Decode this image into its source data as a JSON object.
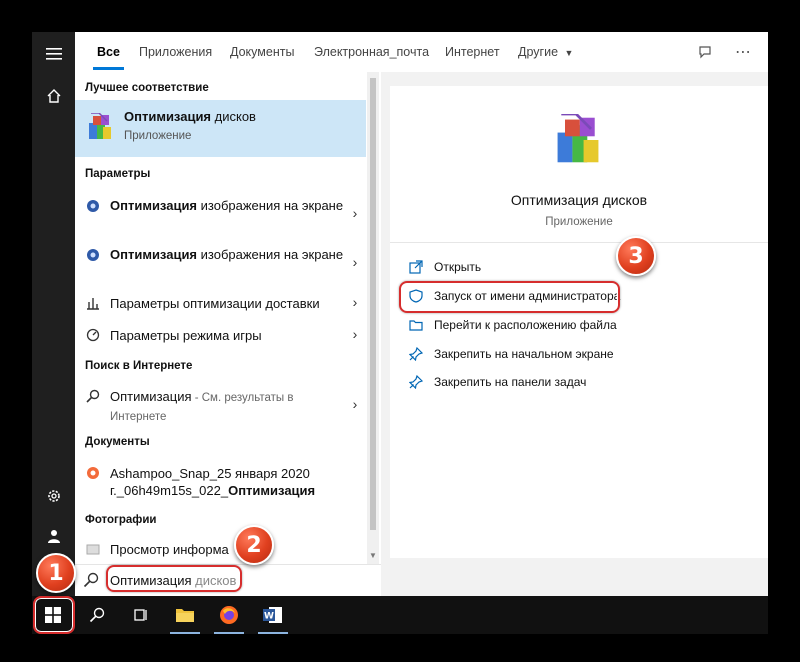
{
  "tabs": {
    "all": "Все",
    "apps": "Приложения",
    "docs": "Документы",
    "email": "Электронная_почта",
    "web": "Интернет",
    "more": "Другие"
  },
  "left": {
    "best_match_heading": "Лучшее соответствие",
    "best": {
      "title_bold": "Оптимизация",
      "title_rest": " дисков",
      "subtitle": "Приложение"
    },
    "settings_heading": "Параметры",
    "settings": [
      {
        "bold": "Оптимизация",
        "rest": " изображения на экране"
      },
      {
        "bold": "Оптимизация",
        "rest": " изображения на экране"
      },
      {
        "bold": "",
        "rest": "Параметры оптимизации доставки"
      },
      {
        "bold": "",
        "rest": "Параметры режима игры"
      }
    ],
    "web_heading": "Поиск в Интернете",
    "web_item": {
      "bold": "Оптимизация",
      "rest": " - См. результаты в Интернете"
    },
    "docs_heading": "Документы",
    "doc_item": {
      "pre": "Ashampoo_Snap_25 января 2020 г._06h49m15s_022_",
      "bold": "Оптимизация"
    },
    "photos_heading": "Фотографии",
    "photo_item": "Просмотр информа"
  },
  "search": {
    "typed": "Оптимизация",
    "ghost": " дисков"
  },
  "preview": {
    "title": "Оптимизация дисков",
    "subtitle": "Приложение",
    "actions": [
      "Открыть",
      "Запуск от имени администратора",
      "Перейти к расположению файла",
      "Закрепить на начальном экране",
      "Закрепить на панели задач"
    ]
  },
  "badges": [
    "1",
    "2",
    "3"
  ],
  "colors": {
    "accent": "#0078d7",
    "selection": "#cde6f7",
    "highlight": "#d62d2d"
  }
}
